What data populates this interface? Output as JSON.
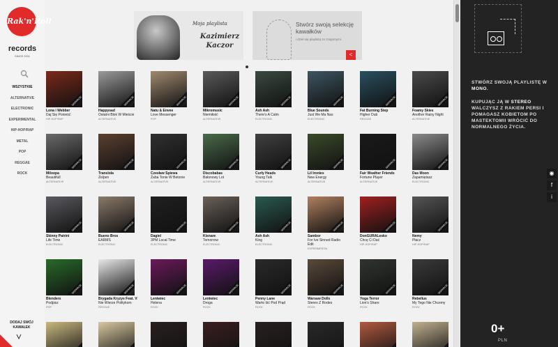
{
  "logo": {
    "badge": "Rak'n'Roll",
    "name": "records",
    "since": "SINCE 2011"
  },
  "genres": [
    "WSZYSTKIE",
    "ALTERNATIVE",
    "ELECTRONIC",
    "EXPERIMENTAL",
    "HIP-HOP/RAP",
    "METAL",
    "POP",
    "REGGAE",
    "ROCK"
  ],
  "add_track": "DODAJ SWÓJ KAWAŁEK",
  "banners": {
    "left": {
      "line1": "Moja playlista",
      "line2": "Kazimierz Kaczor"
    },
    "right": {
      "line1": "Stwórz swoją selekcję kawałków",
      "line2": "i dziel się playlistą ze znajomymi."
    }
  },
  "ribbon": "WSPARCIE",
  "colors": {
    "accent": "#e12a2a",
    "panel": "#232323"
  },
  "albums": [
    {
      "artist": "Lona i Webber",
      "title": "Daj Się Ponieść",
      "genre": "HIP-HOP/RAP",
      "color": "#7a2a1a"
    },
    {
      "artist": "Happysad",
      "title": "Ostatni Blok W Mieście",
      "genre": "ALTERNATIVE",
      "color": "#9a9a9a"
    },
    {
      "artist": "Natu & Envee",
      "title": "Love Messenger",
      "genre": "POP",
      "color": "#a08a70"
    },
    {
      "artist": "Mikromusic",
      "title": "Niemiłość",
      "genre": "ALTERNATIVE",
      "color": "#5a5a5a"
    },
    {
      "artist": "Ash Ash",
      "title": "There's A Calm",
      "genre": "ELECTRONIC",
      "color": "#3a4a40"
    },
    {
      "artist": "Blue Sounds",
      "title": "Just We Ma Nas",
      "genre": "ELECTRONIC",
      "color": "#3e5560"
    },
    {
      "artist": "Fat Burning Step",
      "title": "Higher Dub",
      "genre": "REGGAE",
      "color": "#2a5060"
    },
    {
      "artist": "Foamy Skies",
      "title": "Another Rainy Night",
      "genre": "ALTERNATIVE",
      "color": "#4a4a4a"
    },
    {
      "artist": "Miloopa",
      "title": "Beautifull",
      "genre": "ALTERNATIVE",
      "color": "#6a6a6a"
    },
    {
      "artist": "Translola",
      "title": "Zelpen",
      "genre": "ALTERNATIVE",
      "color": "#5a4030"
    },
    {
      "artist": "Czesław Śpiewa",
      "title": "Żaba Tonie W Betonie",
      "genre": "ALTERNATIVE",
      "color": "#303030"
    },
    {
      "artist": "Discobabas",
      "title": "Balonowy Lot",
      "genre": "ALTERNATIVE",
      "color": "#4a6a4a"
    },
    {
      "artist": "Curly Heads",
      "title": "Young Talk",
      "genre": "ALTERNATIVE",
      "color": "#404040"
    },
    {
      "artist": "Lil Ironies",
      "title": "New Energy",
      "genre": "ALTERNATIVE",
      "color": "#3a4a2a"
    },
    {
      "artist": "Fair Weather Friends",
      "title": "Fortune Player",
      "genre": "ALTERNATIVE",
      "color": "#1a1a1a"
    },
    {
      "artist": "Das Moon",
      "title": "Zapamiętasz",
      "genre": "ELECTRONIC",
      "color": "#8a8a8a"
    },
    {
      "artist": "Skinny Patrini",
      "title": "Life Time",
      "genre": "ELECTRONIC",
      "color": "#5a5a60"
    },
    {
      "artist": "Bueno Bros",
      "title": "EARMS",
      "genre": "ELECTRONIC",
      "color": "#8a7a6a"
    },
    {
      "artist": "Dagiel",
      "title": "3PM Local Time",
      "genre": "ELECTRONIC",
      "color": "#202020"
    },
    {
      "artist": "Kixnare",
      "title": "Tomorrow",
      "genre": "ELECTRONIC",
      "color": "#6a6058"
    },
    {
      "artist": "Ash Ash",
      "title": "King",
      "genre": "ELECTRONIC",
      "color": "#2a5a50"
    },
    {
      "artist": "Sambor",
      "title": "For Ive Sinned Radio Edit",
      "genre": "EXPERIMENTAL",
      "color": "#b08060"
    },
    {
      "artist": "DonGURALesko",
      "title": "Chcę Ci Dać",
      "genre": "HIP-HOP/RAP",
      "color": "#a02020"
    },
    {
      "artist": "Nemy",
      "title": "Płacz",
      "genre": "HIP-HOP/RAP",
      "color": "#555555"
    },
    {
      "artist": "Blenders",
      "title": "Podpisz",
      "genre": "POP",
      "color": "#2a6a2a"
    },
    {
      "artist": "Brygada Kryzys Feat. Vienio i Pele",
      "title": "Nie Wierze Politykom",
      "genre": "REGGAE",
      "color": "#e8e8e8"
    },
    {
      "artist": "Leniwiec",
      "title": "Helena",
      "genre": "ROCK",
      "color": "#6a1a5a"
    },
    {
      "artist": "Leniwiec",
      "title": "Droga",
      "genre": "ROCK",
      "color": "#5a1a6a"
    },
    {
      "artist": "Penny Lane",
      "title": "Warto Iść Pod Prąd",
      "genre": "ROCK",
      "color": "#2a2a2a"
    },
    {
      "artist": "Warsaw Dolls",
      "title": "Stereo Z Rodeo",
      "genre": "ROCK",
      "color": "#5a4a3a"
    },
    {
      "artist": "Yoga Terror",
      "title": "Lion's Share",
      "genre": "ROCK",
      "color": "#303530"
    },
    {
      "artist": "Rebelius",
      "title": "My Tego Nie Chcemy",
      "genre": "ROCK",
      "color": "#3a3a3a"
    },
    {
      "artist": "",
      "title": "",
      "genre": "",
      "color": "#c8b880"
    },
    {
      "artist": "",
      "title": "",
      "genre": "",
      "color": "#d8c8a0"
    },
    {
      "artist": "",
      "title": "",
      "genre": "",
      "color": "#2a2020"
    },
    {
      "artist": "",
      "title": "",
      "genre": "",
      "color": "#3a2020"
    },
    {
      "artist": "",
      "title": "",
      "genre": "",
      "color": "#2a2020"
    },
    {
      "artist": "",
      "title": "",
      "genre": "",
      "color": "#2a2a2a"
    },
    {
      "artist": "",
      "title": "",
      "genre": "",
      "color": "#b05a40"
    },
    {
      "artist": "",
      "title": "",
      "genre": "",
      "color": "#c0b090"
    }
  ],
  "right_panel": {
    "text1_pre": "STWÓRZ SWOJĄ PLAYLISTĘ W ",
    "text1_mono": "MONO",
    "text1_post": ".",
    "text2_pre": "KUPUJĄC JĄ W ",
    "text2_stereo": "STEREO",
    "text2_post": " WALCZYSZ Z RAKIEM PERSI I POMAGASZ KOBIETOM PO MASTEKTOMII WRÓCIĆ DO NORMALNEGO ŻYCIA.",
    "price": "0+",
    "currency": "PLN"
  },
  "social": [
    "◉",
    "f",
    "i"
  ]
}
